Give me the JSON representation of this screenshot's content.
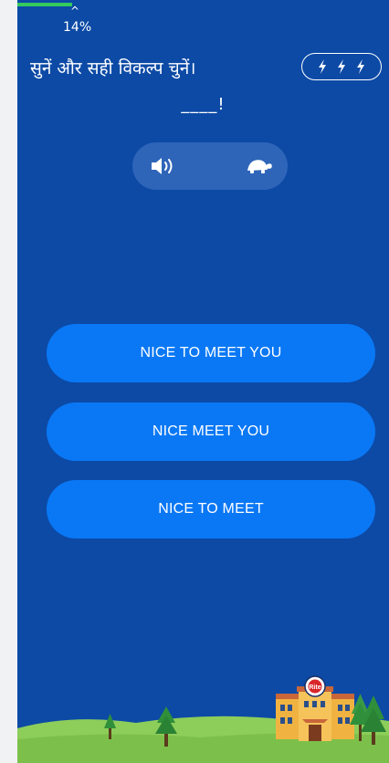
{
  "progress": {
    "caret": "^",
    "label": "14%",
    "value_fraction": 0.14,
    "color": "#34c95c"
  },
  "instruction": "सुनें और सही विकल्प चुनें।",
  "energy": {
    "bolts": 3,
    "icon": "lightning-bolt-icon"
  },
  "answer_blank": "____!",
  "audio": {
    "speaker_icon": "speaker-icon",
    "slow_icon": "turtle-icon"
  },
  "options": [
    {
      "label": "NICE TO MEET YOU"
    },
    {
      "label": "NICE MEET YOU"
    },
    {
      "label": "NICE TO MEET"
    }
  ],
  "badge": {
    "text": "Rite"
  },
  "colors": {
    "background": "#0c4aa6",
    "option_button": "#0a78f5",
    "audio_pill": "#2e65b9",
    "grass": "#7cc04b"
  }
}
